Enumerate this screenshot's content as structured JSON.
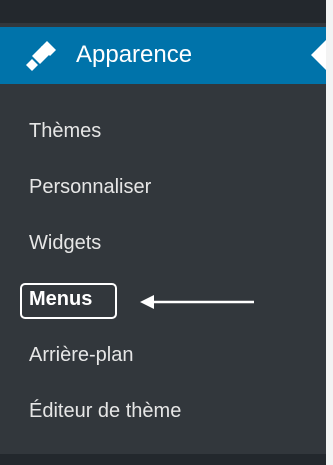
{
  "menu": {
    "header": {
      "label": "Apparence",
      "icon": "paintbrush-icon"
    },
    "items": [
      {
        "label": "Thèmes"
      },
      {
        "label": "Personnaliser"
      },
      {
        "label": "Widgets"
      },
      {
        "label": "Menus",
        "highlighted": true
      },
      {
        "label": "Arrière-plan"
      },
      {
        "label": "Éditeur de thème"
      }
    ]
  },
  "annotation": {
    "type": "arrow",
    "target": "Menus"
  },
  "colors": {
    "sidebar_bg": "#32373c",
    "top_strip": "#23282d",
    "accent": "#0073aa",
    "text": "#e6e6e6",
    "highlight_border": "#ffffff"
  }
}
